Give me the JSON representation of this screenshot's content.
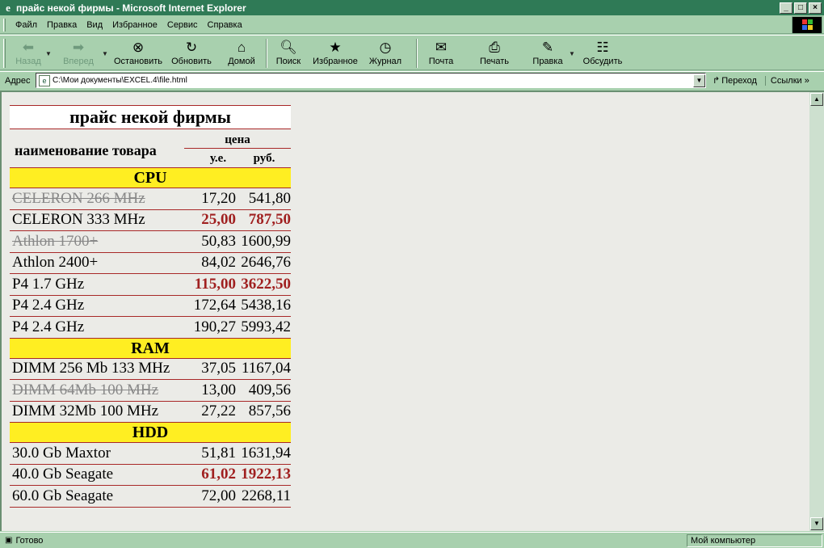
{
  "window": {
    "title": "прайс некой фирмы - Microsoft Internet Explorer",
    "minimize": "_",
    "maximize": "□",
    "close": "×"
  },
  "menu": {
    "items": [
      "Файл",
      "Правка",
      "Вид",
      "Избранное",
      "Сервис",
      "Справка"
    ]
  },
  "toolbar": {
    "back": "Назад",
    "forward": "Вперед",
    "stop": "Остановить",
    "refresh": "Обновить",
    "home": "Домой",
    "search": "Поиск",
    "favorites": "Избранное",
    "history": "Журнал",
    "mail": "Почта",
    "print": "Печать",
    "edit": "Правка",
    "discuss": "Обсудить"
  },
  "address": {
    "label": "Адрес",
    "url": "C:\\Мои документы\\EXCEL.4\\file.html",
    "go": "Переход",
    "links": "Ссылки"
  },
  "status": {
    "text": "Готово",
    "zone": "Мой компьютер"
  },
  "price": {
    "title": "прайс некой фирмы",
    "col_name": "наименование товара",
    "col_price": "цена",
    "col_ue": "у.е.",
    "col_rub": "руб.",
    "categories": [
      {
        "name": "CPU",
        "items": [
          {
            "name": "CELERON 266 MHz",
            "ue": "17,20",
            "rub": "541,80",
            "style": "strike"
          },
          {
            "name": "CELERON 333 MHz",
            "ue": "25,00",
            "rub": "787,50",
            "style": "highlight"
          },
          {
            "name": "Athlon 1700+",
            "ue": "50,83",
            "rub": "1600,99",
            "style": "strike"
          },
          {
            "name": "Athlon 2400+",
            "ue": "84,02",
            "rub": "2646,76",
            "style": "normal"
          },
          {
            "name": "P4 1.7 GHz",
            "ue": "115,00",
            "rub": "3622,50",
            "style": "highlight"
          },
          {
            "name": "P4 2.4 GHz",
            "ue": "172,64",
            "rub": "5438,16",
            "style": "normal"
          },
          {
            "name": "P4 2.4 GHz",
            "ue": "190,27",
            "rub": "5993,42",
            "style": "normal"
          }
        ]
      },
      {
        "name": "RAM",
        "items": [
          {
            "name": "DIMM 256 Mb 133 MHz",
            "ue": "37,05",
            "rub": "1167,04",
            "style": "normal"
          },
          {
            "name": "DIMM 64Mb 100 MHz",
            "ue": "13,00",
            "rub": "409,56",
            "style": "strike"
          },
          {
            "name": "DIMM 32Mb 100 MHz",
            "ue": "27,22",
            "rub": "857,56",
            "style": "normal"
          }
        ]
      },
      {
        "name": "HDD",
        "items": [
          {
            "name": "30.0 Gb Maxtor",
            "ue": "51,81",
            "rub": "1631,94",
            "style": "normal"
          },
          {
            "name": "40.0 Gb Seagate",
            "ue": "61,02",
            "rub": "1922,13",
            "style": "highlight"
          },
          {
            "name": "60.0 Gb Seagate",
            "ue": "72,00",
            "rub": "2268,11",
            "style": "normal"
          }
        ]
      }
    ]
  },
  "colors": {
    "chrome": "#a8d0ae",
    "titlebar": "#2f7a56",
    "category_bg": "#ffee22",
    "rule": "#a82828",
    "highlight_text": "#a02020"
  }
}
